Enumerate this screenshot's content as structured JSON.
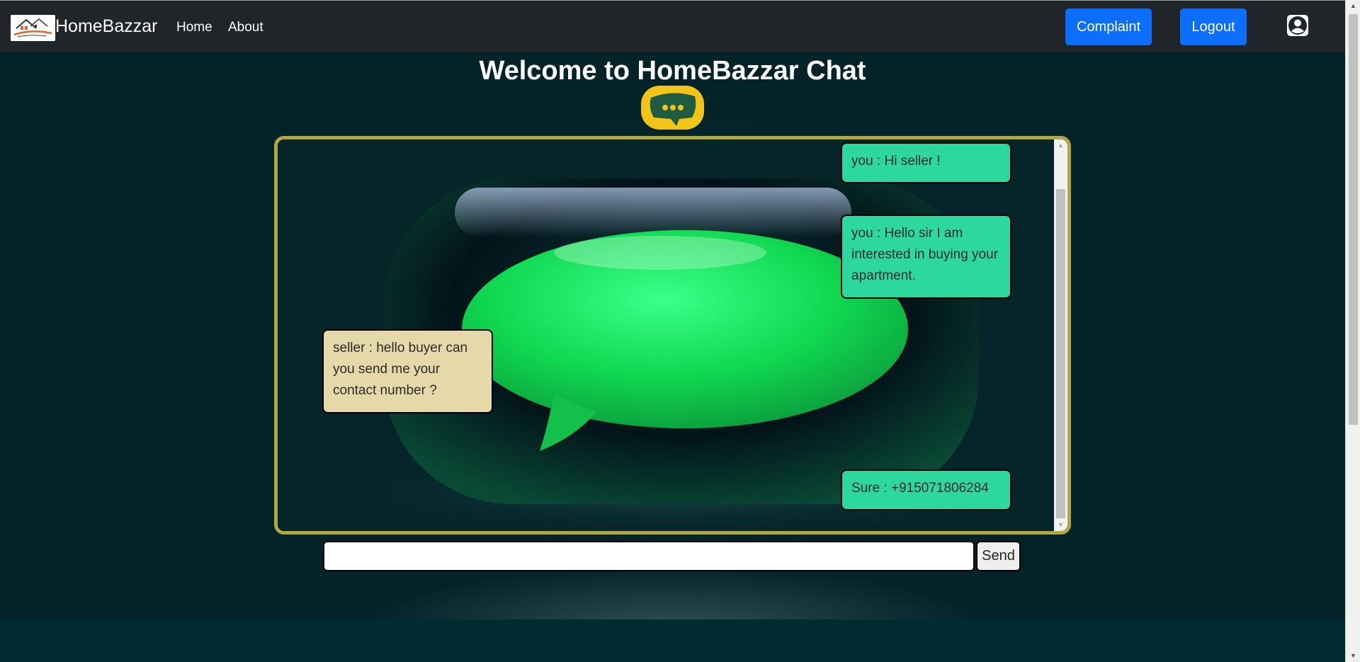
{
  "navbar": {
    "brand": "HomeBazzar",
    "links": [
      {
        "label": "Home"
      },
      {
        "label": "About"
      }
    ],
    "complaint_label": "Complaint",
    "logout_label": "Logout",
    "avatar_icon": "user-circle-icon"
  },
  "hero": {
    "title": "Welcome to HomeBazzar Chat",
    "logo_icon": "chat-bubble-icon"
  },
  "chat": {
    "messages": [
      {
        "sender": "you",
        "text": "you : Hi seller !"
      },
      {
        "sender": "you",
        "text": "you : Hello sir I am interested in buying your apartment."
      },
      {
        "sender": "seller",
        "text": "seller : hello buyer can you send me your contact number ?"
      },
      {
        "sender": "you",
        "text": "Sure : +915071806284"
      }
    ],
    "input_value": "",
    "send_label": "Send"
  },
  "colors": {
    "navbar_bg": "#212529",
    "primary_button": "#0d6efd",
    "chat_border": "#b2a642",
    "my_bubble": "#2dd89f",
    "their_bubble": "#e5d9a9",
    "page_bg": "#05262b"
  }
}
